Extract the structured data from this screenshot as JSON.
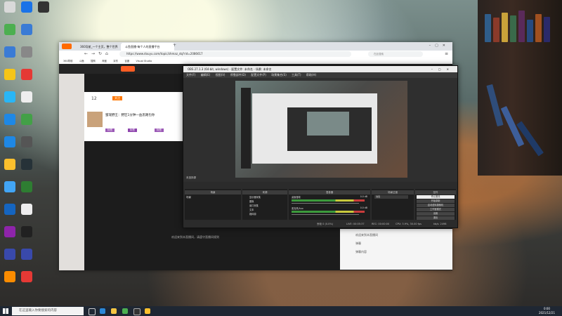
{
  "desktop": {
    "icons": [
      {
        "label": "",
        "color": "#d9d9d9",
        "col": 0,
        "row": 0
      },
      {
        "label": "",
        "color": "#1a73e8",
        "col": 1,
        "row": 0
      },
      {
        "label": "",
        "color": "#333333",
        "col": 2,
        "row": 0
      },
      {
        "label": "",
        "color": "#4caf50",
        "col": 0,
        "row": 1
      },
      {
        "label": "",
        "color": "#3a7bd5",
        "col": 1,
        "row": 1
      },
      {
        "label": "",
        "color": "#3a7bd5",
        "col": 0,
        "row": 2
      },
      {
        "label": "",
        "color": "#888888",
        "col": 1,
        "row": 2
      },
      {
        "label": "",
        "color": "#f5c518",
        "col": 0,
        "row": 3
      },
      {
        "label": "",
        "color": "#e53935",
        "col": 1,
        "row": 3
      },
      {
        "label": "",
        "color": "#29b6f6",
        "col": 0,
        "row": 4
      },
      {
        "label": "",
        "color": "#eeeeee",
        "col": 1,
        "row": 4
      },
      {
        "label": "",
        "color": "#1e88e5",
        "col": 0,
        "row": 5
      },
      {
        "label": "",
        "color": "#43a047",
        "col": 1,
        "row": 5
      },
      {
        "label": "",
        "color": "#1e88e5",
        "col": 0,
        "row": 6
      },
      {
        "label": "",
        "color": "#555555",
        "col": 1,
        "row": 6
      },
      {
        "label": "",
        "color": "#fbc02d",
        "col": 0,
        "row": 7
      },
      {
        "label": "",
        "color": "#263238",
        "col": 1,
        "row": 7
      },
      {
        "label": "",
        "color": "#42a5f5",
        "col": 0,
        "row": 8
      },
      {
        "label": "",
        "color": "#2e7d32",
        "col": 1,
        "row": 8
      },
      {
        "label": "",
        "color": "#1565c0",
        "col": 0,
        "row": 9
      },
      {
        "label": "",
        "color": "#eeeeee",
        "col": 1,
        "row": 9
      },
      {
        "label": "",
        "color": "#8e24aa",
        "col": 0,
        "row": 10
      },
      {
        "label": "",
        "color": "#212121",
        "col": 1,
        "row": 10
      },
      {
        "label": "",
        "color": "#3949ab",
        "col": 0,
        "row": 11
      },
      {
        "label": "",
        "color": "#3949ab",
        "col": 1,
        "row": 11
      },
      {
        "label": "",
        "color": "#fb8c00",
        "col": 0,
        "row": 12
      },
      {
        "label": "",
        "color": "#e53935",
        "col": 1,
        "row": 12
      }
    ]
  },
  "browser": {
    "tabs": [
      {
        "label": "360导航_一个主页，整个世界",
        "active": false
      },
      {
        "label": "斗鱼直播-每个人的直播平台",
        "active": true
      }
    ],
    "new_tab": "+",
    "url": "https://www.douyu.com/topic/zhmaz_dq?rid=2086617",
    "search_placeholder": "在此搜索",
    "bookmarks": [
      "360导航",
      "斗鱼",
      "搜狗",
      "淘宝",
      "京东",
      "百度",
      "Visual Studio"
    ],
    "page": {
      "viewer_count": "12",
      "room_title": "蜜瑞野王：野区1分钟一血思路包你",
      "follow_label": "关注",
      "tags": [
        "标签",
        "标签",
        "标签"
      ],
      "comments": [
        {
          "user": "",
          "text": "欢迎来到本直播间"
        },
        {
          "user": "",
          "text": "弹幕"
        },
        {
          "user": "",
          "text": "弹幕内容"
        }
      ],
      "bottom_notice": "欢迎来到本直播间，请遵守直播间规则"
    }
  },
  "obs": {
    "title": "OBS 27.1.3 (64-bit, windows) - 配置文件: 未命名 - 场景: 未命名",
    "menu": [
      "文件(F)",
      "编辑(E)",
      "视图(V)",
      "停靠部件(D)",
      "配置文件(P)",
      "场景集合(S)",
      "工具(T)",
      "帮助(H)"
    ],
    "docks": {
      "scenes_header": "场景",
      "sources_header": "来源",
      "mixer_header": "混音器",
      "transitions_header": "场景过渡",
      "controls_header": "控件"
    },
    "scenes": [
      "场景"
    ],
    "sources": [
      "显示器采集",
      "图像",
      "窗口采集",
      "文本",
      "媒体源",
      "窗口采集"
    ],
    "mixer": [
      {
        "name": "桌面音频",
        "level": "0.0 dB"
      },
      {
        "name": "麦克风/Aux",
        "level": "0.0 dB"
      }
    ],
    "transition": {
      "type": "淡出",
      "duration_label": "时长"
    },
    "controls": [
      "停止推流",
      "开始录制",
      "启动虚拟摄像机",
      "工作室模式",
      "设置",
      "退出"
    ],
    "status": {
      "dropped": "丢帧 0 (0.0%)",
      "live": "LIVE: 00:05:37",
      "rec": "REC: 00:00:00",
      "cpu": "CPU: 3.9%, 30.00 fps",
      "kbps": "kb/s: 2498"
    },
    "scenes_label": "未选择源"
  },
  "taskbar": {
    "search_placeholder": "在这里输入你要搜索的内容",
    "time": "0:00",
    "date": "2021/12/21"
  }
}
